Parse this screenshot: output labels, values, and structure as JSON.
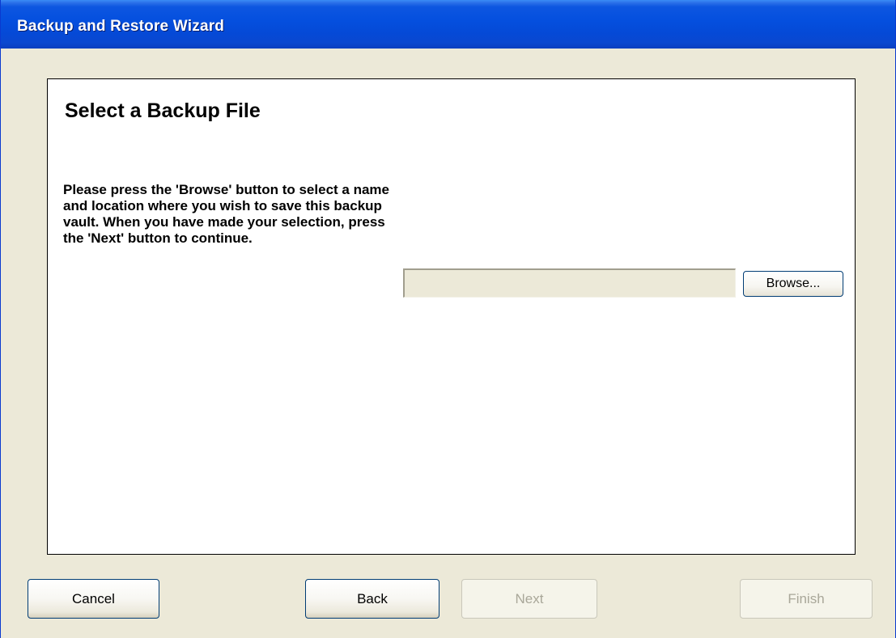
{
  "window": {
    "title": "Backup and Restore Wizard"
  },
  "page": {
    "heading": "Select a Backup File",
    "instructions": "Please press the 'Browse' button to select a name and location where you wish to save this backup vault. When you have made your selection, press the 'Next' button to continue."
  },
  "file_selection": {
    "path_value": "",
    "browse_label": "Browse..."
  },
  "buttons": {
    "cancel": {
      "label": "Cancel",
      "enabled": true
    },
    "back": {
      "label": "Back",
      "enabled": true
    },
    "next": {
      "label": "Next",
      "enabled": false
    },
    "finish": {
      "label": "Finish",
      "enabled": false
    }
  },
  "colors": {
    "titlebar": "#0550df",
    "dialog_background": "#ece9d8",
    "button_border": "#003c74",
    "disabled_text": "#a9a799"
  }
}
